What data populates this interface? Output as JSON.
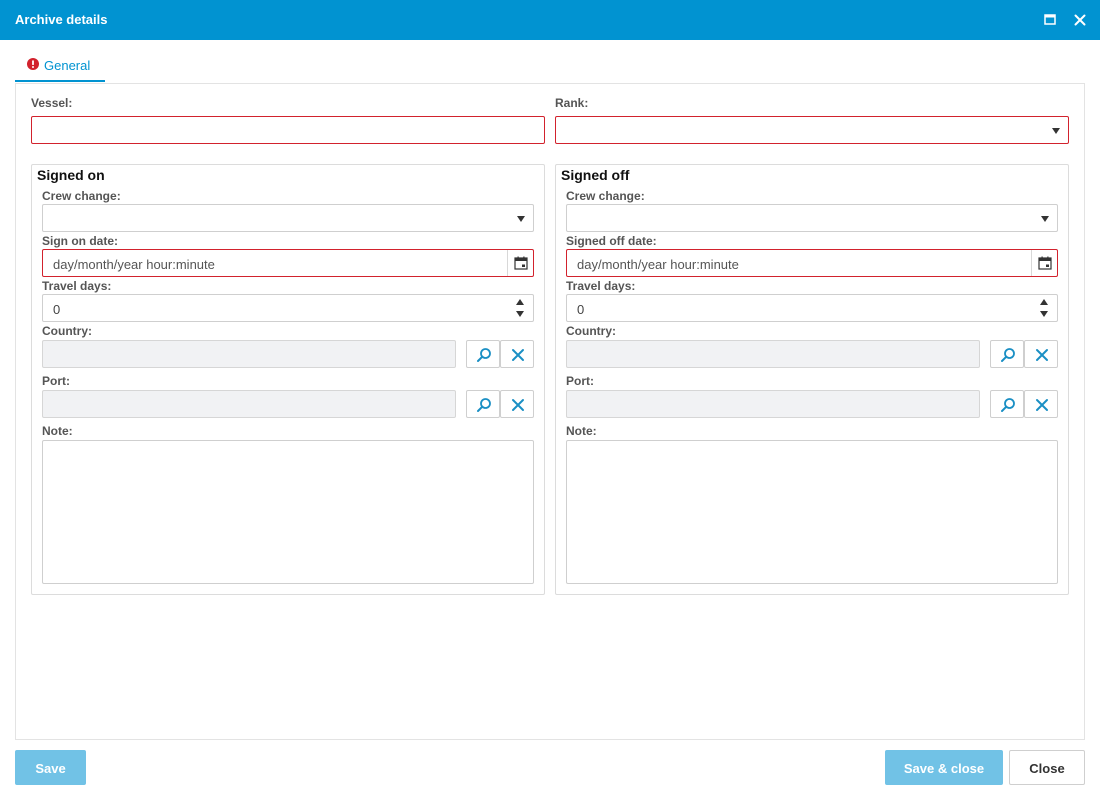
{
  "window": {
    "title": "Archive details",
    "maximize_icon": "maximize-icon",
    "close_icon": "close-icon"
  },
  "tabs": [
    {
      "label": "General",
      "icon": "error-icon",
      "icon_color": "#d2222d",
      "active": true
    }
  ],
  "form": {
    "vessel": {
      "label": "Vessel:",
      "value": ""
    },
    "rank": {
      "label": "Rank:",
      "value": ""
    }
  },
  "signed_on": {
    "title": "Signed on",
    "crew_change": {
      "label": "Crew change:",
      "value": ""
    },
    "date": {
      "label": "Sign on date:",
      "placeholder": "day/month/year hour:minute"
    },
    "travel_days": {
      "label": "Travel days:",
      "value": "0"
    },
    "country": {
      "label": "Country:",
      "value": ""
    },
    "port": {
      "label": "Port:",
      "value": ""
    },
    "note": {
      "label": "Note:",
      "value": ""
    }
  },
  "signed_off": {
    "title": "Signed off",
    "crew_change": {
      "label": "Crew change:",
      "value": ""
    },
    "date": {
      "label": "Signed off date:",
      "placeholder": "day/month/year hour:minute"
    },
    "travel_days": {
      "label": "Travel days:",
      "value": "0"
    },
    "country": {
      "label": "Country:",
      "value": ""
    },
    "port": {
      "label": "Port:",
      "value": ""
    },
    "note": {
      "label": "Note:",
      "value": ""
    }
  },
  "footer": {
    "save_label": "Save",
    "save_close_label": "Save & close",
    "close_label": "Close"
  },
  "colors": {
    "accent": "#0193d1",
    "primary_button": "#71c2e6",
    "error": "#d2222d",
    "icon_action": "#1a8fc4"
  }
}
